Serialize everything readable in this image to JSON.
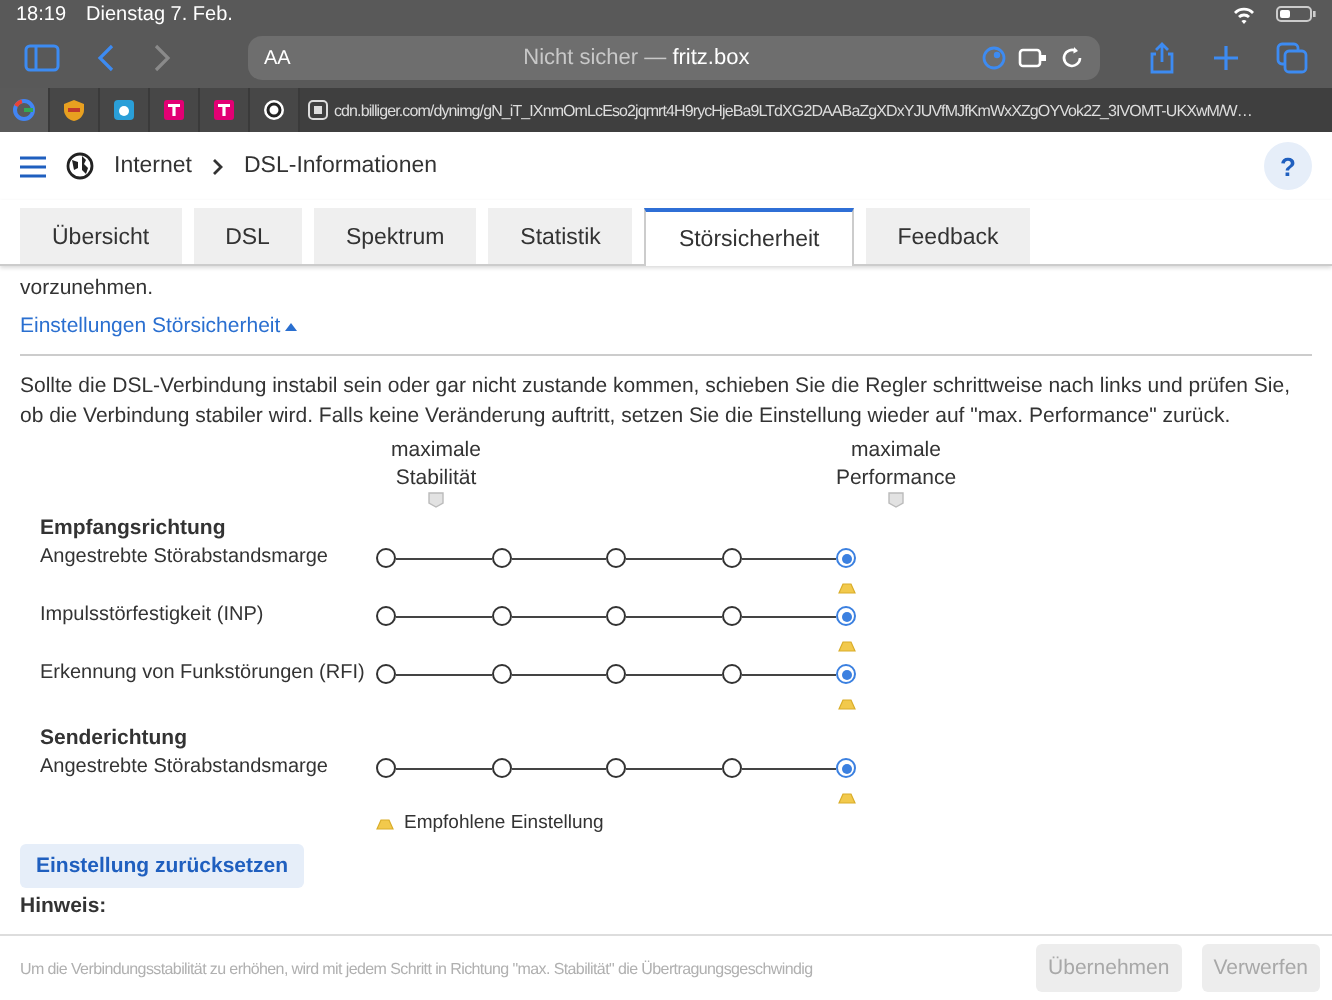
{
  "status_bar": {
    "time": "18:19",
    "date": "Dienstag 7. Feb."
  },
  "toolbar": {
    "text_size": "AA",
    "address": {
      "prefix": "Nicht sicher —",
      "host": "fritz.box"
    }
  },
  "browser_tabs": [
    {
      "kind": "google",
      "selected": true
    },
    {
      "kind": "shield",
      "selected": false
    },
    {
      "kind": "cloud",
      "selected": false
    },
    {
      "kind": "telekom",
      "selected": false
    },
    {
      "kind": "telekom",
      "selected": false
    },
    {
      "kind": "ring",
      "selected": false
    },
    {
      "kind": "page",
      "selected": false,
      "label": "cdn.billiger.com/dynimg/gN_iT_IXnmOmLcEso2jqmrt4H9rycHjeBa9LTdXG2DAABaZgXDxYJUVfMJfKmWxXZgOYVok2Z_3IVOMT-UKXwM/W…"
    }
  ],
  "header": {
    "breadcrumb": [
      "Internet",
      "DSL-Informationen"
    ],
    "help": "?"
  },
  "tabs": [
    {
      "label": "Übersicht",
      "selected": false
    },
    {
      "label": "DSL",
      "selected": false
    },
    {
      "label": "Spektrum",
      "selected": false
    },
    {
      "label": "Statistik",
      "selected": false
    },
    {
      "label": "Störsicherheit",
      "selected": true
    },
    {
      "label": "Feedback",
      "selected": false
    }
  ],
  "intro_tail": "vorzunehmen.",
  "settings_link": {
    "label": "Einstellungen Störsicherheit",
    "expanded": true
  },
  "description": "Sollte die DSL-Verbindung instabil sein oder gar nicht zustande kommen, schieben Sie die Regler schrittweise nach links und prüfen Sie, ob die Verbindung stabiler wird. Falls keine Veränderung auftritt, setzen Sie die Einstellung wieder auf \"max. Performance\" zurück.",
  "scale_labels": {
    "left": [
      "maximale",
      "Stabilität"
    ],
    "right": [
      "maximale",
      "Performance"
    ]
  },
  "groups": [
    {
      "title": "Empfangsrichtung",
      "sliders": [
        {
          "label": "Angestrebte Störabstandsmarge",
          "steps": [
            {
              "selected": false,
              "recommended": false
            },
            {
              "selected": false,
              "recommended": false
            },
            {
              "selected": false,
              "recommended": false
            },
            {
              "selected": false,
              "recommended": false
            },
            {
              "selected": true,
              "recommended": true
            }
          ]
        },
        {
          "label": "Impulsstörfestigkeit (INP)",
          "steps": [
            {
              "selected": false,
              "recommended": false
            },
            {
              "selected": false,
              "recommended": false
            },
            {
              "selected": false,
              "recommended": false
            },
            {
              "selected": false,
              "recommended": false
            },
            {
              "selected": true,
              "recommended": true
            }
          ]
        },
        {
          "label": "Erkennung von Funkstörungen (RFI)",
          "steps": [
            {
              "selected": false,
              "recommended": false
            },
            {
              "selected": false,
              "recommended": false
            },
            {
              "selected": false,
              "recommended": false
            },
            {
              "selected": false,
              "recommended": false
            },
            {
              "selected": true,
              "recommended": true
            }
          ]
        }
      ]
    },
    {
      "title": "Senderichtung",
      "sliders": [
        {
          "label": "Angestrebte Störabstandsmarge",
          "steps": [
            {
              "selected": false,
              "recommended": false
            },
            {
              "selected": false,
              "recommended": false
            },
            {
              "selected": false,
              "recommended": false
            },
            {
              "selected": false,
              "recommended": false
            },
            {
              "selected": true,
              "recommended": true
            }
          ]
        }
      ]
    }
  ],
  "legend": "Empfohlene Einstellung",
  "reset_button": "Einstellung zurücksetzen",
  "note_title": "Hinweis:",
  "note_text": "Um die Verbindungsstabilität zu erhöhen, wird mit jedem Schritt in Richtung \"max. Stabilität\" die Übertragungsgeschwindig",
  "footer_buttons": [
    {
      "label": "Übernehmen",
      "disabled": true
    },
    {
      "label": "Verwerfen",
      "disabled": true
    }
  ]
}
